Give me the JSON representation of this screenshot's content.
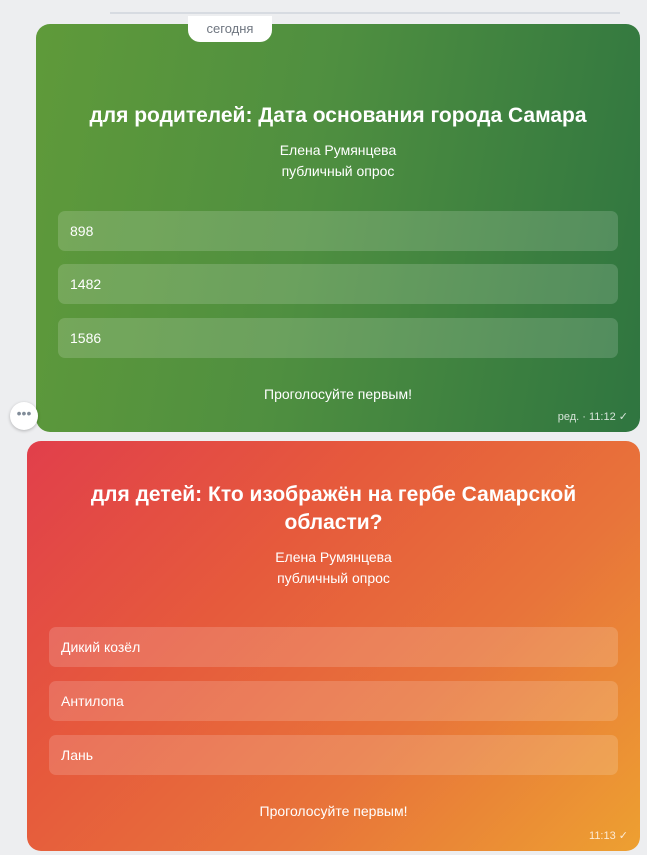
{
  "feed": {
    "date_label": "сегодня",
    "more_button_glyph": "•••"
  },
  "polls": [
    {
      "title": "для родителей: Дата основания города Самара",
      "author": "Елена Румянцева",
      "type": "публичный опрос",
      "options": [
        "898",
        "1482",
        "1586"
      ],
      "cta": "Проголосуйте первым!",
      "meta": "ред. · 11:12 ✓",
      "colors": {
        "start": "#5f9a3a",
        "end": "#2f7540"
      }
    },
    {
      "title": "для детей: Кто изображён на гербе Самарской области?",
      "author": "Елена Румянцева",
      "type": "публичный опрос",
      "options": [
        "Дикий козёл",
        "Антилопа",
        "Лань"
      ],
      "cta": "Проголосуйте первым!",
      "meta": "11:13 ✓",
      "colors": {
        "start": "#e13f4b",
        "end": "#eda031"
      }
    }
  ]
}
